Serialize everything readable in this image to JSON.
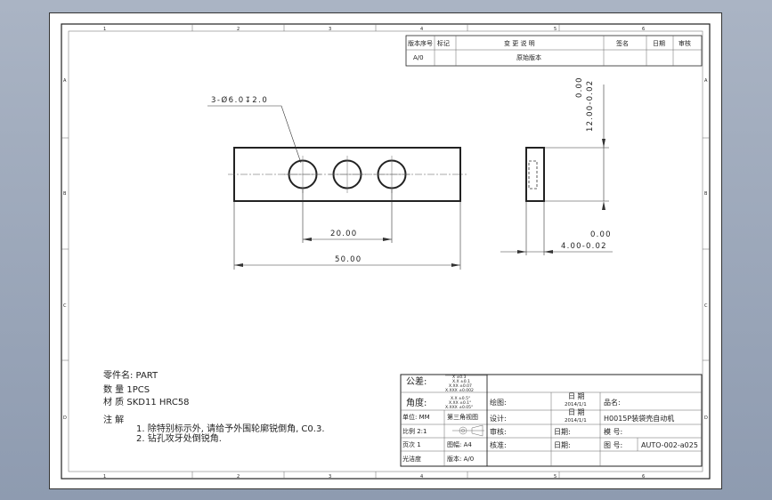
{
  "border": {
    "top_zones": [
      "1",
      "2",
      "3",
      "4",
      "5",
      "6"
    ],
    "bottom_zones": [
      "1",
      "2",
      "3",
      "4",
      "5",
      "6"
    ],
    "left_zones": [
      "A",
      "B",
      "C",
      "D"
    ],
    "right_zones": [
      "A",
      "B",
      "C",
      "D"
    ]
  },
  "revision_table": {
    "headers": [
      "版本序号",
      "标记",
      "变  更  说  明",
      "签名",
      "日期",
      "审核"
    ],
    "row": {
      "version": "A/0",
      "description": "原始版本"
    }
  },
  "dimensions": {
    "holes_callout": "3-Ø6.0↧2.0",
    "hole_pitch": "20.00",
    "overall_length": "50.00",
    "height_zero": "0.00",
    "height_value": "12.00-0.02",
    "thickness_zero": "0.00",
    "thickness_value": "4.00-0.02"
  },
  "notes": {
    "part_name": "零件名: PART",
    "quantity": "数  量  1PCS",
    "material": "材  质  SKD11  HRC58",
    "notes_title": "注  解",
    "note1": "1. 除特别标示外, 请给予外围轮廓锐倒角, C0.3.",
    "note2": "2. 钻孔攻牙处倒锐角."
  },
  "title_block": {
    "tolerance_label": "公差:",
    "tolerance_values": [
      "X ±0.3",
      "X.X ±0.1",
      "X.XX ±0.07",
      "X.XXX ±0.002"
    ],
    "angle_label": "角度:",
    "angle_values": [
      "X.X ±0.5°",
      "X.XX ±0.1°",
      "X.XXX ±0.05°"
    ],
    "unit": "单位: MM",
    "projection": "第三角视图",
    "scale": "比例  2:1",
    "pages": "页次    1",
    "paper": "图幅:  A4",
    "finish": "光洁度",
    "revision": "版本: A/0",
    "draw_label": "绘图:",
    "date_label_1": "日  期",
    "date_1": "2014/1/1",
    "design_label": "设计:",
    "date_label_2": "日  期",
    "date_2": "2014/1/1",
    "review_label": "审核:",
    "review_date_label": "日期:",
    "approve_label": "核准:",
    "approve_date_label": "日期:",
    "product_label": "品名:",
    "product_name": "H0015P装袋壳自动机",
    "model_label": "模  号:",
    "drawing_no_label": "图  号:",
    "drawing_no": "AUTO-002-a025"
  }
}
